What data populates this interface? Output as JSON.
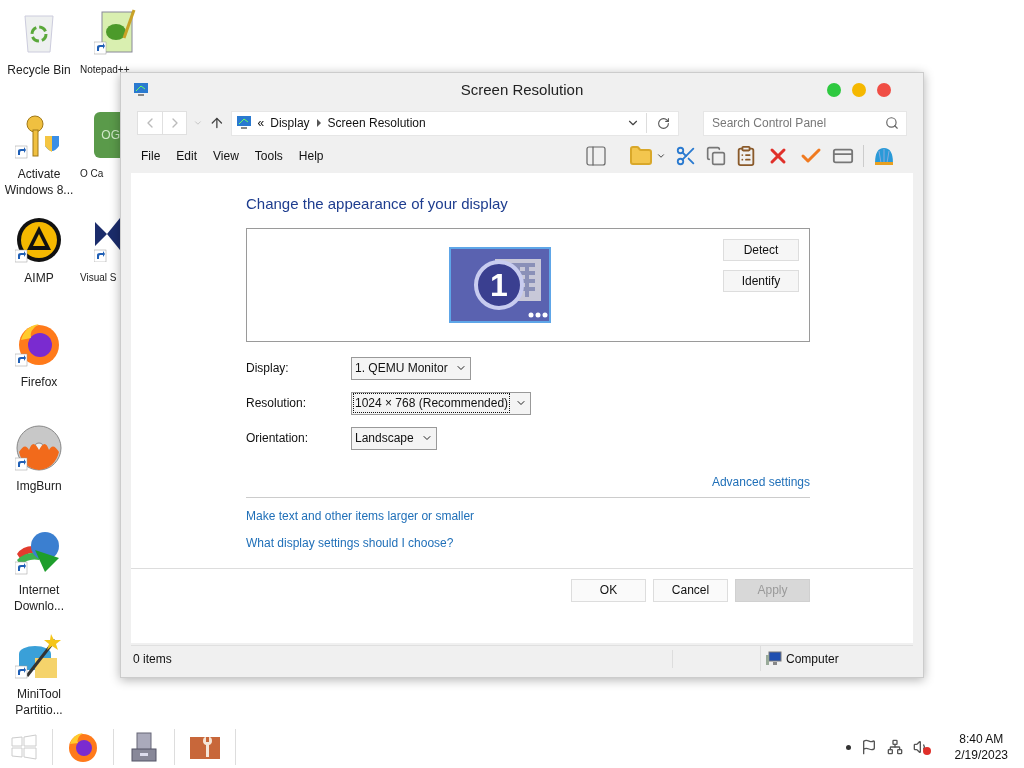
{
  "desktop_icons": [
    {
      "kind": "recycle",
      "label": "Recycle Bin"
    },
    {
      "kind": "key",
      "label": "Activate Windows 8..."
    },
    {
      "kind": "aimp",
      "label": "AIMP"
    },
    {
      "kind": "firefox",
      "label": "Firefox"
    },
    {
      "kind": "disc",
      "label": "ImgBurn"
    },
    {
      "kind": "globe",
      "label": "Internet Downlo..."
    },
    {
      "kind": "wand",
      "label": "MiniTool Partitio..."
    },
    {
      "kind": "notepad",
      "label": "Notepad++"
    },
    {
      "kind": "tile",
      "label": "O Ca",
      "tile_text": "OG"
    },
    {
      "kind": "vs",
      "label": "Visual S"
    }
  ],
  "window": {
    "title": "Screen Resolution",
    "address": {
      "prefix": "«",
      "segments": [
        "Display",
        "Screen Resolution"
      ]
    },
    "search": {
      "placeholder": "Search Control Panel"
    },
    "menu": [
      "File",
      "Edit",
      "View",
      "Tools",
      "Help"
    ],
    "heading": "Change the appearance of your display",
    "monitor": {
      "number": "1"
    },
    "preview_buttons": [
      "Detect",
      "Identify"
    ],
    "fields": [
      {
        "label": "Display:",
        "value": "1. QEMU Monitor",
        "focused": false
      },
      {
        "label": "Resolution:",
        "value": "1024 × 768 (Recommended)",
        "focused": true
      },
      {
        "label": "Orientation:",
        "value": "Landscape",
        "focused": false
      }
    ],
    "advanced_link": "Advanced settings",
    "links": [
      "Make text and other items larger or smaller",
      "What display settings should I choose?"
    ],
    "buttons": [
      {
        "label": "OK",
        "disabled": false
      },
      {
        "label": "Cancel",
        "disabled": false
      },
      {
        "label": "Apply",
        "disabled": true
      }
    ],
    "status_bar": {
      "count": "0 items",
      "location": "Computer"
    }
  },
  "taskbar": {
    "apps": [
      {
        "kind": "firefox"
      },
      {
        "kind": "drive"
      },
      {
        "kind": "tools"
      }
    ],
    "clock": {
      "time": "8:40 AM",
      "date": "2/19/2023"
    }
  }
}
